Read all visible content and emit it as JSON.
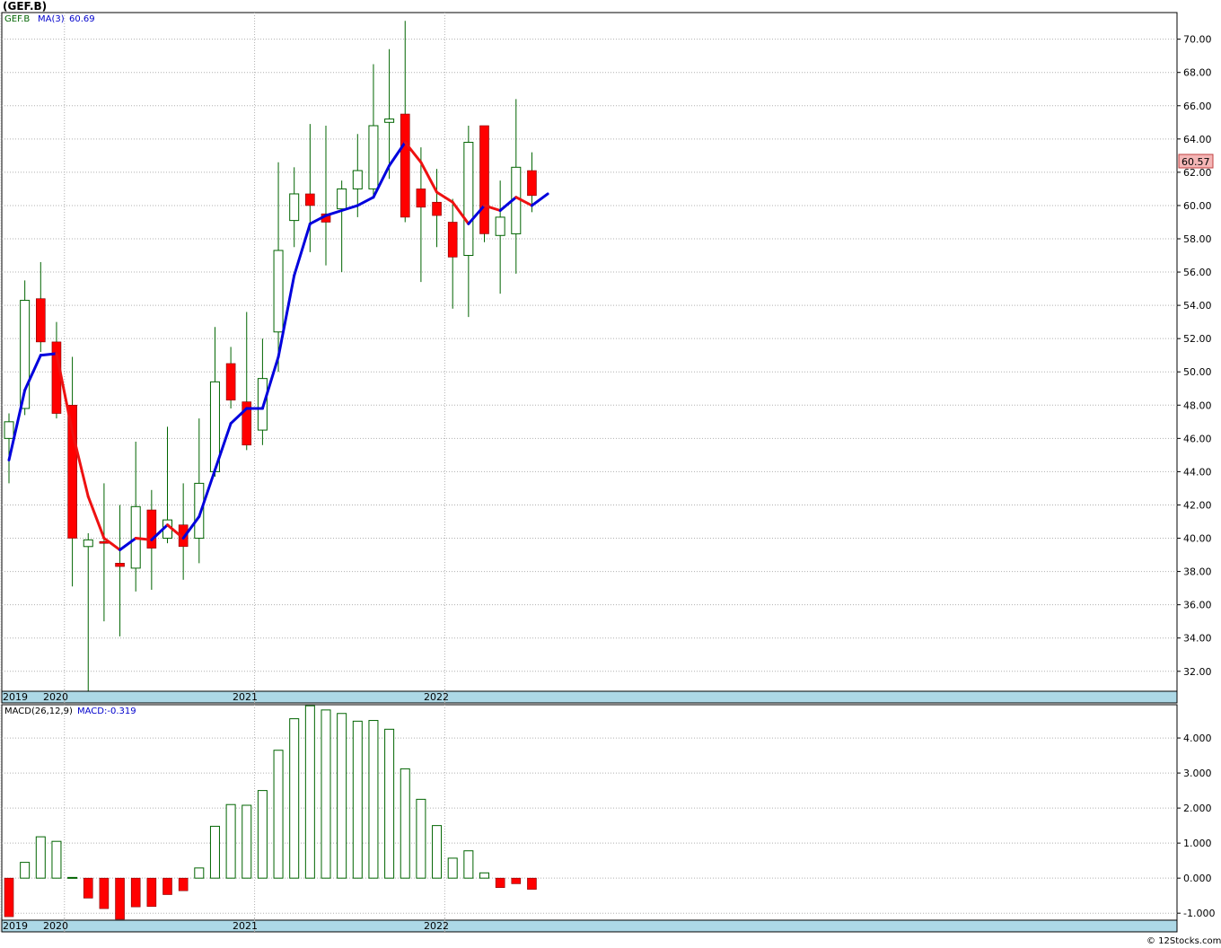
{
  "title": "(GEF.B)",
  "legend": {
    "symbol": "GEF.B",
    "ma_label": "MA(3)",
    "ma_value": "60.69"
  },
  "last_price_badge": "60.57",
  "macd_legend": {
    "label": "MACD(26,12,9)",
    "value_label": "MACD:-0.319"
  },
  "credit": "© 12Stocks.com",
  "colors": {
    "up": "#006400",
    "down": "#ff0000",
    "ma_up": "#0000dd",
    "ma_down": "#ee1111",
    "axis_band": "#add8e6",
    "grid": "#b0b0b0",
    "badge_bg": "#f4b6b6"
  },
  "chart_data": [
    {
      "type": "candlestick",
      "period": "monthly",
      "x_tick_labels": [
        "2019",
        "2020",
        "2021",
        "2022"
      ],
      "y_tick_labels": [
        "32.00",
        "34.00",
        "36.00",
        "38.00",
        "40.00",
        "42.00",
        "44.00",
        "46.00",
        "48.00",
        "50.00",
        "52.00",
        "54.00",
        "56.00",
        "58.00",
        "60.00",
        "62.00",
        "64.00",
        "66.00",
        "68.00",
        "70.00"
      ],
      "ylim": [
        30.8,
        71.6
      ],
      "grid": true,
      "candles": [
        {
          "o": 46.0,
          "h": 47.5,
          "l": 43.3,
          "c": 47.0
        },
        {
          "o": 47.8,
          "h": 55.5,
          "l": 47.4,
          "c": 54.3
        },
        {
          "o": 54.4,
          "h": 56.6,
          "l": 51.2,
          "c": 51.8
        },
        {
          "o": 51.8,
          "h": 53.0,
          "l": 47.2,
          "c": 47.5
        },
        {
          "o": 48.0,
          "h": 50.9,
          "l": 37.1,
          "c": 40.0
        },
        {
          "o": 39.5,
          "h": 40.3,
          "l": 30.8,
          "c": 39.9
        },
        {
          "o": 39.8,
          "h": 43.3,
          "l": 35.0,
          "c": 39.7
        },
        {
          "o": 38.5,
          "h": 42.0,
          "l": 34.1,
          "c": 38.3
        },
        {
          "o": 38.2,
          "h": 45.8,
          "l": 36.8,
          "c": 41.9
        },
        {
          "o": 41.7,
          "h": 42.9,
          "l": 36.9,
          "c": 39.4
        },
        {
          "o": 40.0,
          "h": 46.7,
          "l": 39.7,
          "c": 41.1
        },
        {
          "o": 40.8,
          "h": 43.3,
          "l": 37.5,
          "c": 39.5
        },
        {
          "o": 40.0,
          "h": 47.2,
          "l": 38.5,
          "c": 43.3
        },
        {
          "o": 44.0,
          "h": 52.7,
          "l": 43.7,
          "c": 49.4
        },
        {
          "o": 50.5,
          "h": 51.5,
          "l": 47.8,
          "c": 48.3
        },
        {
          "o": 48.2,
          "h": 53.6,
          "l": 45.3,
          "c": 45.6
        },
        {
          "o": 46.5,
          "h": 52.0,
          "l": 45.6,
          "c": 49.6
        },
        {
          "o": 52.4,
          "h": 62.6,
          "l": 50.0,
          "c": 57.3
        },
        {
          "o": 59.1,
          "h": 62.3,
          "l": 57.5,
          "c": 60.7
        },
        {
          "o": 60.7,
          "h": 64.9,
          "l": 57.2,
          "c": 60.0
        },
        {
          "o": 59.5,
          "h": 64.8,
          "l": 56.4,
          "c": 59.0
        },
        {
          "o": 59.8,
          "h": 61.5,
          "l": 56.0,
          "c": 61.0
        },
        {
          "o": 61.0,
          "h": 64.3,
          "l": 59.3,
          "c": 62.1
        },
        {
          "o": 61.0,
          "h": 68.5,
          "l": 60.4,
          "c": 64.8
        },
        {
          "o": 65.0,
          "h": 69.4,
          "l": 61.6,
          "c": 65.2
        },
        {
          "o": 65.5,
          "h": 71.1,
          "l": 59.0,
          "c": 59.3
        },
        {
          "o": 61.0,
          "h": 63.5,
          "l": 55.4,
          "c": 59.9
        },
        {
          "o": 60.2,
          "h": 62.2,
          "l": 57.5,
          "c": 59.4
        },
        {
          "o": 59.0,
          "h": 60.4,
          "l": 53.8,
          "c": 56.9
        },
        {
          "o": 57.0,
          "h": 64.8,
          "l": 53.3,
          "c": 63.8
        },
        {
          "o": 64.8,
          "h": 64.8,
          "l": 57.8,
          "c": 58.3
        },
        {
          "o": 58.2,
          "h": 61.5,
          "l": 54.7,
          "c": 59.3
        },
        {
          "o": 58.3,
          "h": 66.4,
          "l": 55.9,
          "c": 62.3
        },
        {
          "o": 62.1,
          "h": 63.2,
          "l": 59.6,
          "c": 60.6
        }
      ],
      "ma3": [
        44.7,
        48.9,
        51.0,
        51.1,
        46.4,
        42.5,
        40.0,
        39.3,
        40.0,
        39.9,
        40.8,
        40.0,
        41.3,
        44.1,
        46.9,
        47.8,
        47.8,
        50.9,
        55.8,
        58.9,
        59.4,
        59.7,
        60.0,
        60.5,
        62.4,
        63.8,
        62.6,
        60.8,
        60.2,
        58.9,
        60.0,
        59.7,
        60.5,
        60.0,
        60.7
      ]
    },
    {
      "type": "bar",
      "name": "MACD(26,12,9)",
      "y_tick_labels": [
        "-1.000",
        "0.000",
        "1.000",
        "2.000",
        "3.000",
        "4.000"
      ],
      "ylim": [
        -1.2,
        4.95
      ],
      "grid": true,
      "values": [
        -1.1,
        0.45,
        1.18,
        1.05,
        0.02,
        -0.57,
        -0.87,
        -1.2,
        -0.82,
        -0.81,
        -0.47,
        -0.36,
        0.29,
        1.48,
        2.1,
        2.08,
        2.5,
        3.65,
        4.55,
        4.92,
        4.8,
        4.7,
        4.48,
        4.5,
        4.25,
        3.12,
        2.25,
        1.5,
        0.57,
        0.78,
        0.15,
        -0.27,
        -0.16,
        -0.32
      ]
    }
  ]
}
